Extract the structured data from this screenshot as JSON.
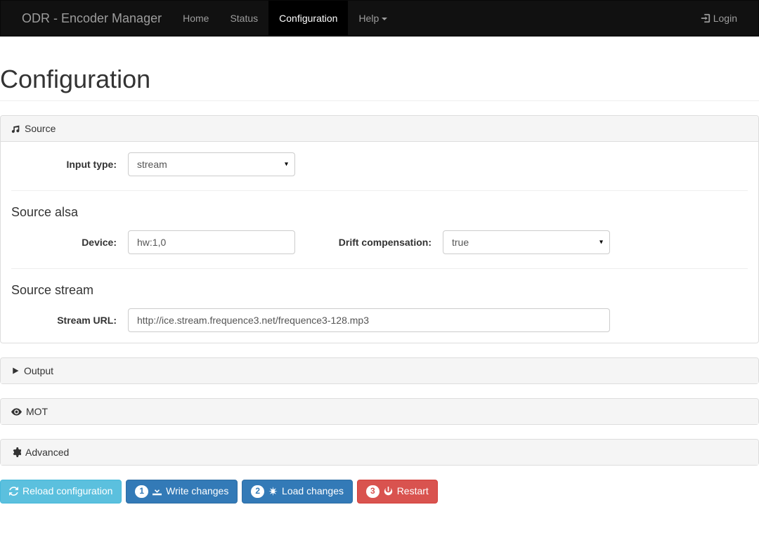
{
  "brand": "ODR - Encoder Manager",
  "nav": {
    "home": "Home",
    "status": "Status",
    "configuration": "Configuration",
    "help": "Help",
    "login": "Login"
  },
  "page_title": "Configuration",
  "panels": {
    "source": {
      "title": "Source",
      "input_type_label": "Input type:",
      "input_type_value": "stream",
      "alsa_title": "Source alsa",
      "device_label": "Device:",
      "device_value": "hw:1,0",
      "drift_label": "Drift compensation:",
      "drift_value": "true",
      "stream_title": "Source stream",
      "stream_url_label": "Stream URL:",
      "stream_url_value": "http://ice.stream.frequence3.net/frequence3-128.mp3"
    },
    "output": {
      "title": "Output"
    },
    "mot": {
      "title": "MOT"
    },
    "advanced": {
      "title": "Advanced"
    }
  },
  "buttons": {
    "reload": "Reload configuration",
    "write": {
      "badge": "1",
      "label": "Write changes"
    },
    "load": {
      "badge": "2",
      "label": "Load changes"
    },
    "restart": {
      "badge": "3",
      "label": "Restart"
    }
  }
}
